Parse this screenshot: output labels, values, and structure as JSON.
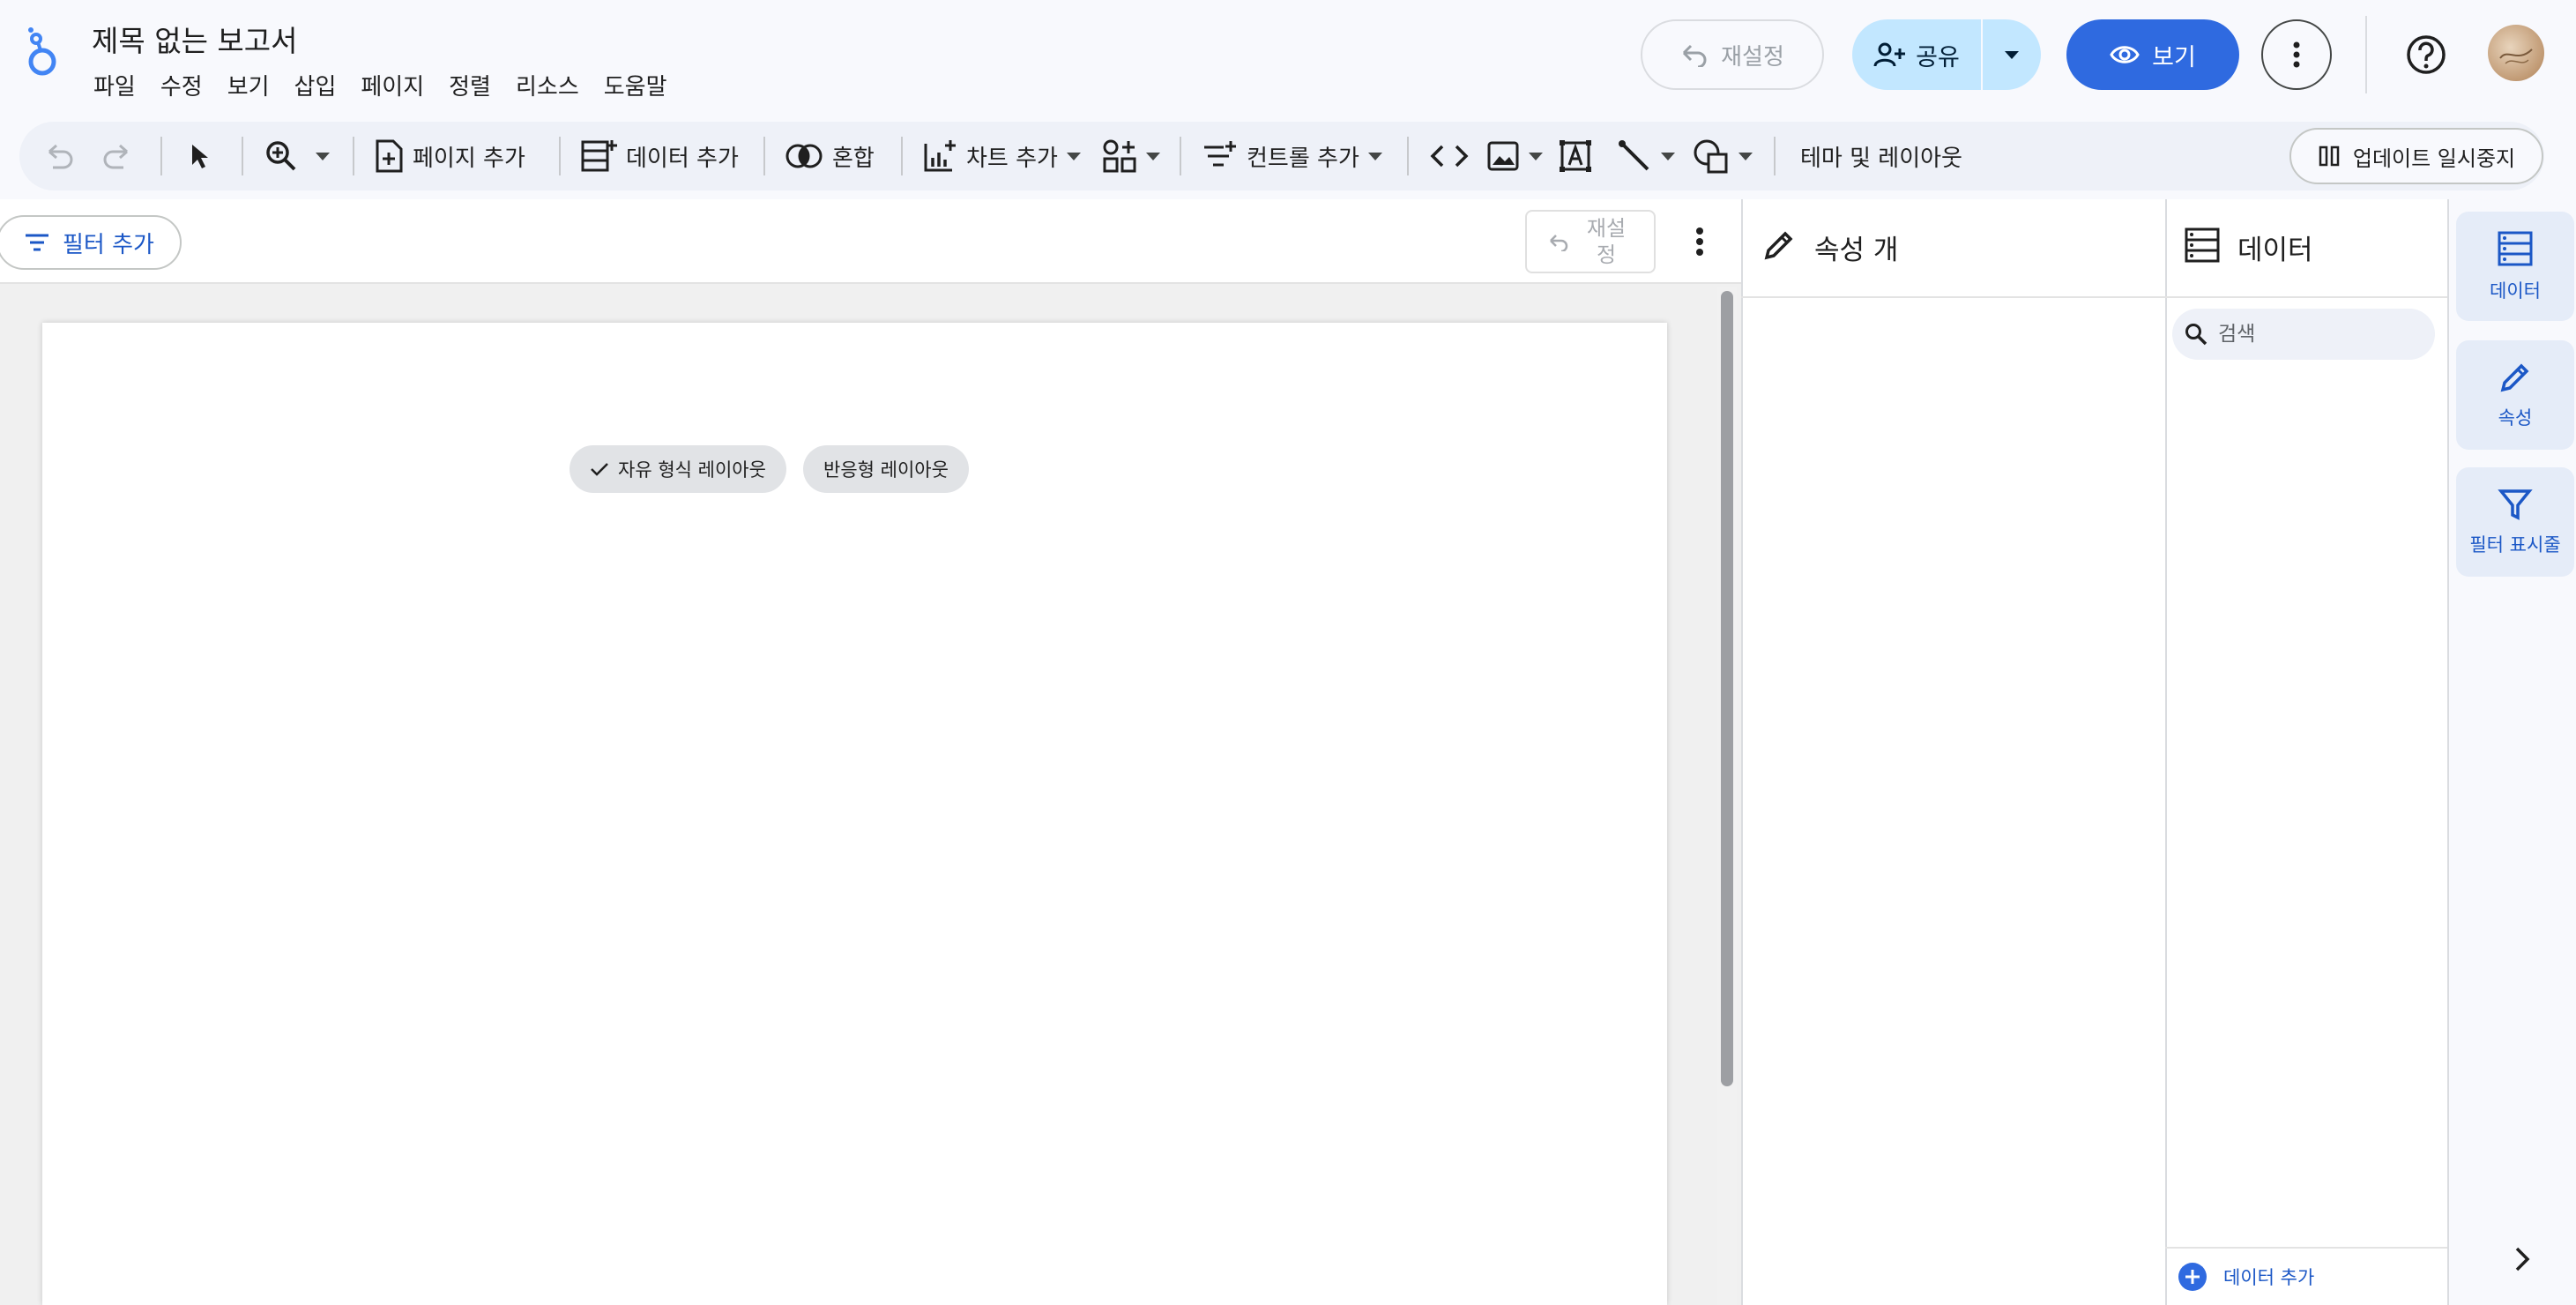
{
  "header": {
    "title": "제목 없는 보고서",
    "menu": [
      "파일",
      "수정",
      "보기",
      "삽입",
      "페이지",
      "정렬",
      "리소스",
      "도움말"
    ],
    "reset_label": "재설정",
    "share_label": "공유",
    "view_label": "보기"
  },
  "toolbar": {
    "add_page": "페이지 추가",
    "add_data": "데이터 추가",
    "blend": "혼합",
    "add_chart": "차트 추가",
    "add_control": "컨트롤 추가",
    "theme_layout": "테마 및 레이아웃",
    "pause_updates": "업데이트 일시중지"
  },
  "canvas": {
    "add_filter": "필터 추가",
    "reset_label": "재설\n정",
    "layout_chips": [
      "자유 형식 레이아웃",
      "반응형 레이아웃"
    ]
  },
  "properties_panel": {
    "title": "속성 개"
  },
  "data_panel": {
    "title": "데이터",
    "search_placeholder": "검색",
    "add_data": "데이터 추가"
  },
  "rail": {
    "items": [
      "데이터",
      "속성",
      "필터 표시줄"
    ]
  },
  "colors": {
    "primary": "#2f6ae0",
    "share_bg": "#c2e7ff",
    "link": "#1b57c6",
    "rail_active": "#e5ecf8"
  }
}
